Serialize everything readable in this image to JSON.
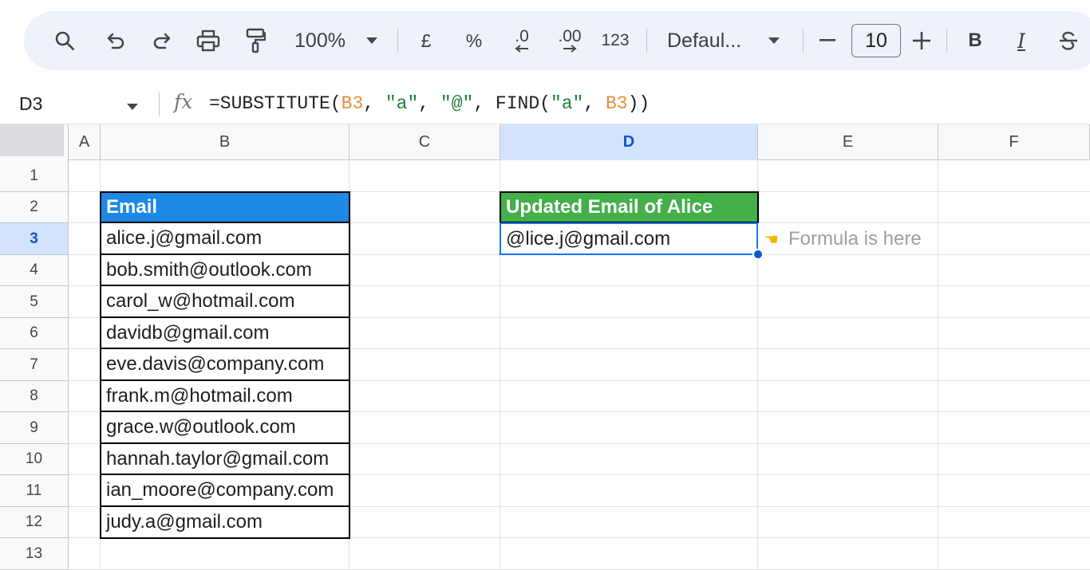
{
  "toolbar": {
    "zoom": "100%",
    "currency": "£",
    "percent": "%",
    "decrease_decimal": ".0",
    "increase_decimal": ".00",
    "number_format": "123",
    "font_family": "Defaul...",
    "font_size": "10",
    "bold": "B",
    "italic": "I"
  },
  "formula_bar": {
    "cell_ref": "D3",
    "fx": "fx",
    "formula_parts": {
      "p1": "=SUBSTITUTE(",
      "p2": "B3",
      "p3": ", ",
      "p4": "\"a\"",
      "p5": ", ",
      "p6": "\"@\"",
      "p7": ", FIND(",
      "p8": "\"a\"",
      "p9": ", ",
      "p10": "B3",
      "p11": "))"
    }
  },
  "columns": [
    "A",
    "B",
    "C",
    "D",
    "E",
    "F"
  ],
  "rows": [
    "1",
    "2",
    "3",
    "4",
    "5",
    "6",
    "7",
    "8",
    "9",
    "10",
    "11",
    "12",
    "13"
  ],
  "active_cell": {
    "column": "D",
    "row": "3"
  },
  "email_table": {
    "header": "Email",
    "values": [
      "alice.j@gmail.com",
      "bob.smith@outlook.com",
      "carol_w@hotmail.com",
      "davidb@gmail.com",
      "eve.davis@company.com",
      "frank.m@hotmail.com",
      "grace.w@outlook.com",
      "hannah.taylor@gmail.com",
      "ian_moore@company.com",
      "judy.a@gmail.com"
    ]
  },
  "result_table": {
    "header": "Updated Email of Alice",
    "value": "@lice.j@gmail.com"
  },
  "note": {
    "icon": "pointing-hand-icon",
    "text": "Formula is here"
  },
  "colors": {
    "toolbar_bg": "#eef2f9",
    "email_header_bg": "#1e88e5",
    "result_header_bg": "#43b049",
    "selection": "#1a73e8",
    "active_header_bg": "#d3e3fd"
  }
}
